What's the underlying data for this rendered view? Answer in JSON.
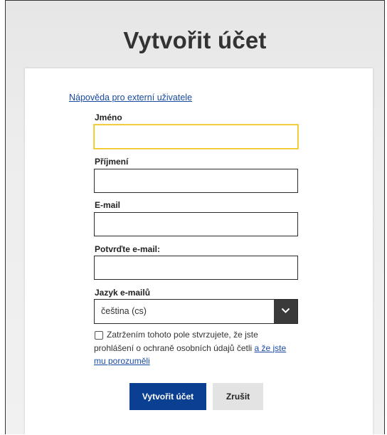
{
  "page": {
    "title": "Vytvořit účet"
  },
  "form": {
    "help_link": "Nápověda pro externí uživatele",
    "first_name": {
      "label": "Jméno",
      "value": ""
    },
    "last_name": {
      "label": "Příjmení",
      "value": ""
    },
    "email": {
      "label": "E-mail",
      "value": ""
    },
    "email_confirm": {
      "label": "Potvrďte e-mail:",
      "value": ""
    },
    "language": {
      "label": "Jazyk e-mailů",
      "selected": "čeština (cs)"
    },
    "consent": {
      "checked": false,
      "text": "Zatržením tohoto pole stvrzujete, že jste prohlášení o ochraně osobních údajů četli",
      "link_text": "a že jste mu porozuměli"
    },
    "submit_label": "Vytvořit účet",
    "cancel_label": "Zrušit"
  },
  "icons": {
    "select_arrow": "chevron-down-icon"
  },
  "colors": {
    "primary": "#0b3f91",
    "link": "#1a4ba0",
    "focus": "#f1c40f"
  }
}
